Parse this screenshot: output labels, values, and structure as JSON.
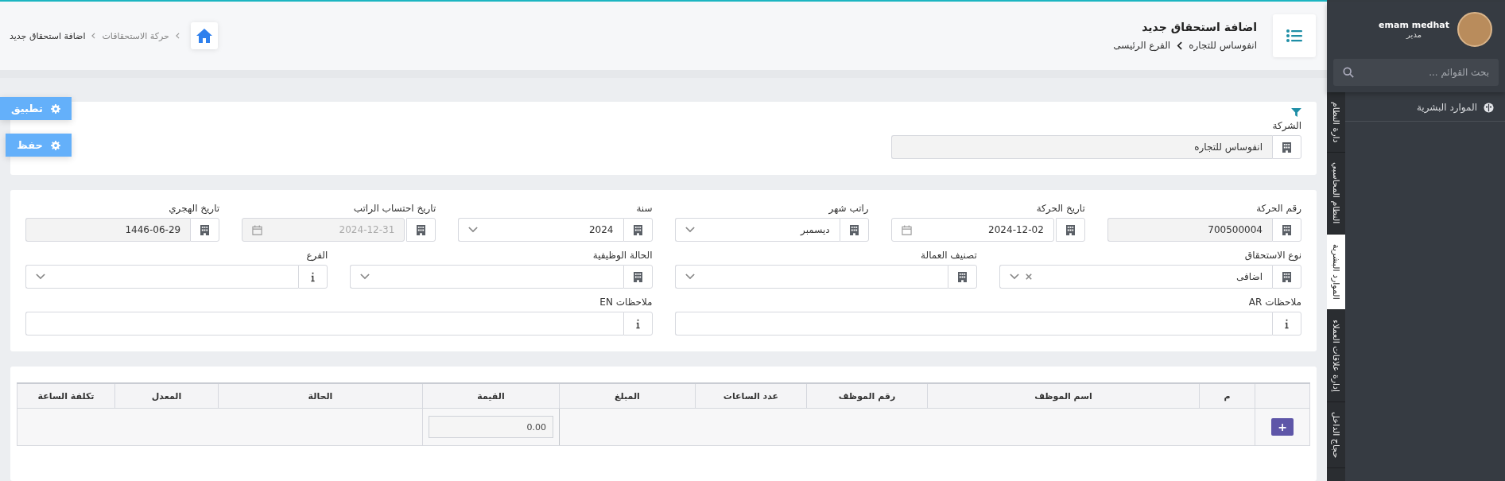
{
  "header": {
    "title": "اضافة استحقاق جديد",
    "breadcrumb": [
      "انفوساس للتجاره",
      "الفرع الرئيسى"
    ],
    "page_path": [
      "حركة الاستحقاقات",
      "اضافة استحقاق جديد"
    ]
  },
  "actions": [
    {
      "label": "تطبيق"
    },
    {
      "label": "حفظ"
    }
  ],
  "filter": {
    "fields": [
      {
        "label": "الشركة",
        "kind": "text",
        "addon": {
          "kind": "building"
        },
        "value": "انفوساس للتجاره",
        "readonly": true
      }
    ]
  },
  "form": {
    "rows": [
      {
        "fields": [
          {
            "label": "رقم الحركة",
            "kind": "text",
            "addon": {
              "kind": "building"
            },
            "value": "700500004",
            "readonly": true
          },
          {
            "label": "تاريخ الحركة",
            "kind": "date",
            "addon": {
              "kind": "building"
            },
            "value": "2024-12-02",
            "readonly": false
          },
          {
            "label": "راتب شهر",
            "kind": "select",
            "addon": {
              "kind": "building"
            },
            "value": "ديسمبر",
            "readonly": false,
            "clearable": false
          },
          {
            "label": "سنة",
            "kind": "select",
            "addon": {
              "kind": "building"
            },
            "value": "2024",
            "readonly": false,
            "clearable": false
          },
          {
            "label": "تاريخ احتساب الراتب",
            "kind": "date",
            "addon": {
              "kind": "building"
            },
            "value": "2024-12-31",
            "readonly": true
          },
          {
            "label": "تاريخ الهجري",
            "kind": "text",
            "addon": {
              "kind": "building"
            },
            "value": "1446-06-29",
            "readonly": true
          }
        ]
      },
      {
        "fields": [
          {
            "label": "نوع الاستحقاق",
            "kind": "select",
            "addon": {
              "kind": "building"
            },
            "value": "اضافى",
            "readonly": false,
            "clearable": true
          },
          {
            "label": "تصنيف العمالة",
            "kind": "select",
            "addon": {
              "kind": "building"
            },
            "readonly": false,
            "clearable": false
          },
          {
            "label": "الحالة الوظيفية",
            "kind": "select",
            "addon": {
              "kind": "building"
            },
            "readonly": false,
            "clearable": false
          },
          {
            "label": "الفرع",
            "kind": "select",
            "addon": {
              "kind": "info"
            },
            "readonly": false,
            "clearable": false
          }
        ]
      },
      {
        "fields": [
          {
            "label": "ملاحظات AR",
            "kind": "text",
            "addon": {
              "kind": "info"
            },
            "readonly": false
          },
          {
            "label": "ملاحظات EN",
            "kind": "text",
            "addon": {
              "kind": "info"
            },
            "readonly": false
          }
        ]
      }
    ]
  },
  "table": {
    "columns": [
      {
        "label": "م",
        "kind": "text"
      },
      {
        "label": "اسم الموظف",
        "kind": "text"
      },
      {
        "label": "رقم الموظف",
        "kind": "text"
      },
      {
        "label": "عدد الساعات",
        "kind": "text"
      },
      {
        "label": "المبلغ",
        "kind": "text"
      },
      {
        "label": "القيمة",
        "kind": "input"
      },
      {
        "label": "الحالة",
        "kind": "text"
      },
      {
        "label": "المعدل",
        "kind": "text"
      },
      {
        "label": "تكلفة الساعة",
        "kind": "text"
      }
    ],
    "entry_row": {
      "add_label": "+",
      "amount": "0.00"
    }
  },
  "sidebar": {
    "user": {
      "name": "emam medhat",
      "role": "مدير"
    },
    "search": {
      "placeholder": "بحث القوائم ..."
    },
    "items": [
      {
        "label": "الموارد البشرية"
      }
    ],
    "tabs": [
      {
        "label": "دارة النظام",
        "selected": false
      },
      {
        "label": "النظام المحاسبي",
        "selected": false
      },
      {
        "label": "الموارد البشرية",
        "selected": true
      },
      {
        "label": "إدارة علاقات العملاء",
        "selected": false
      },
      {
        "label": "حجاج الداخل",
        "selected": false
      }
    ]
  }
}
